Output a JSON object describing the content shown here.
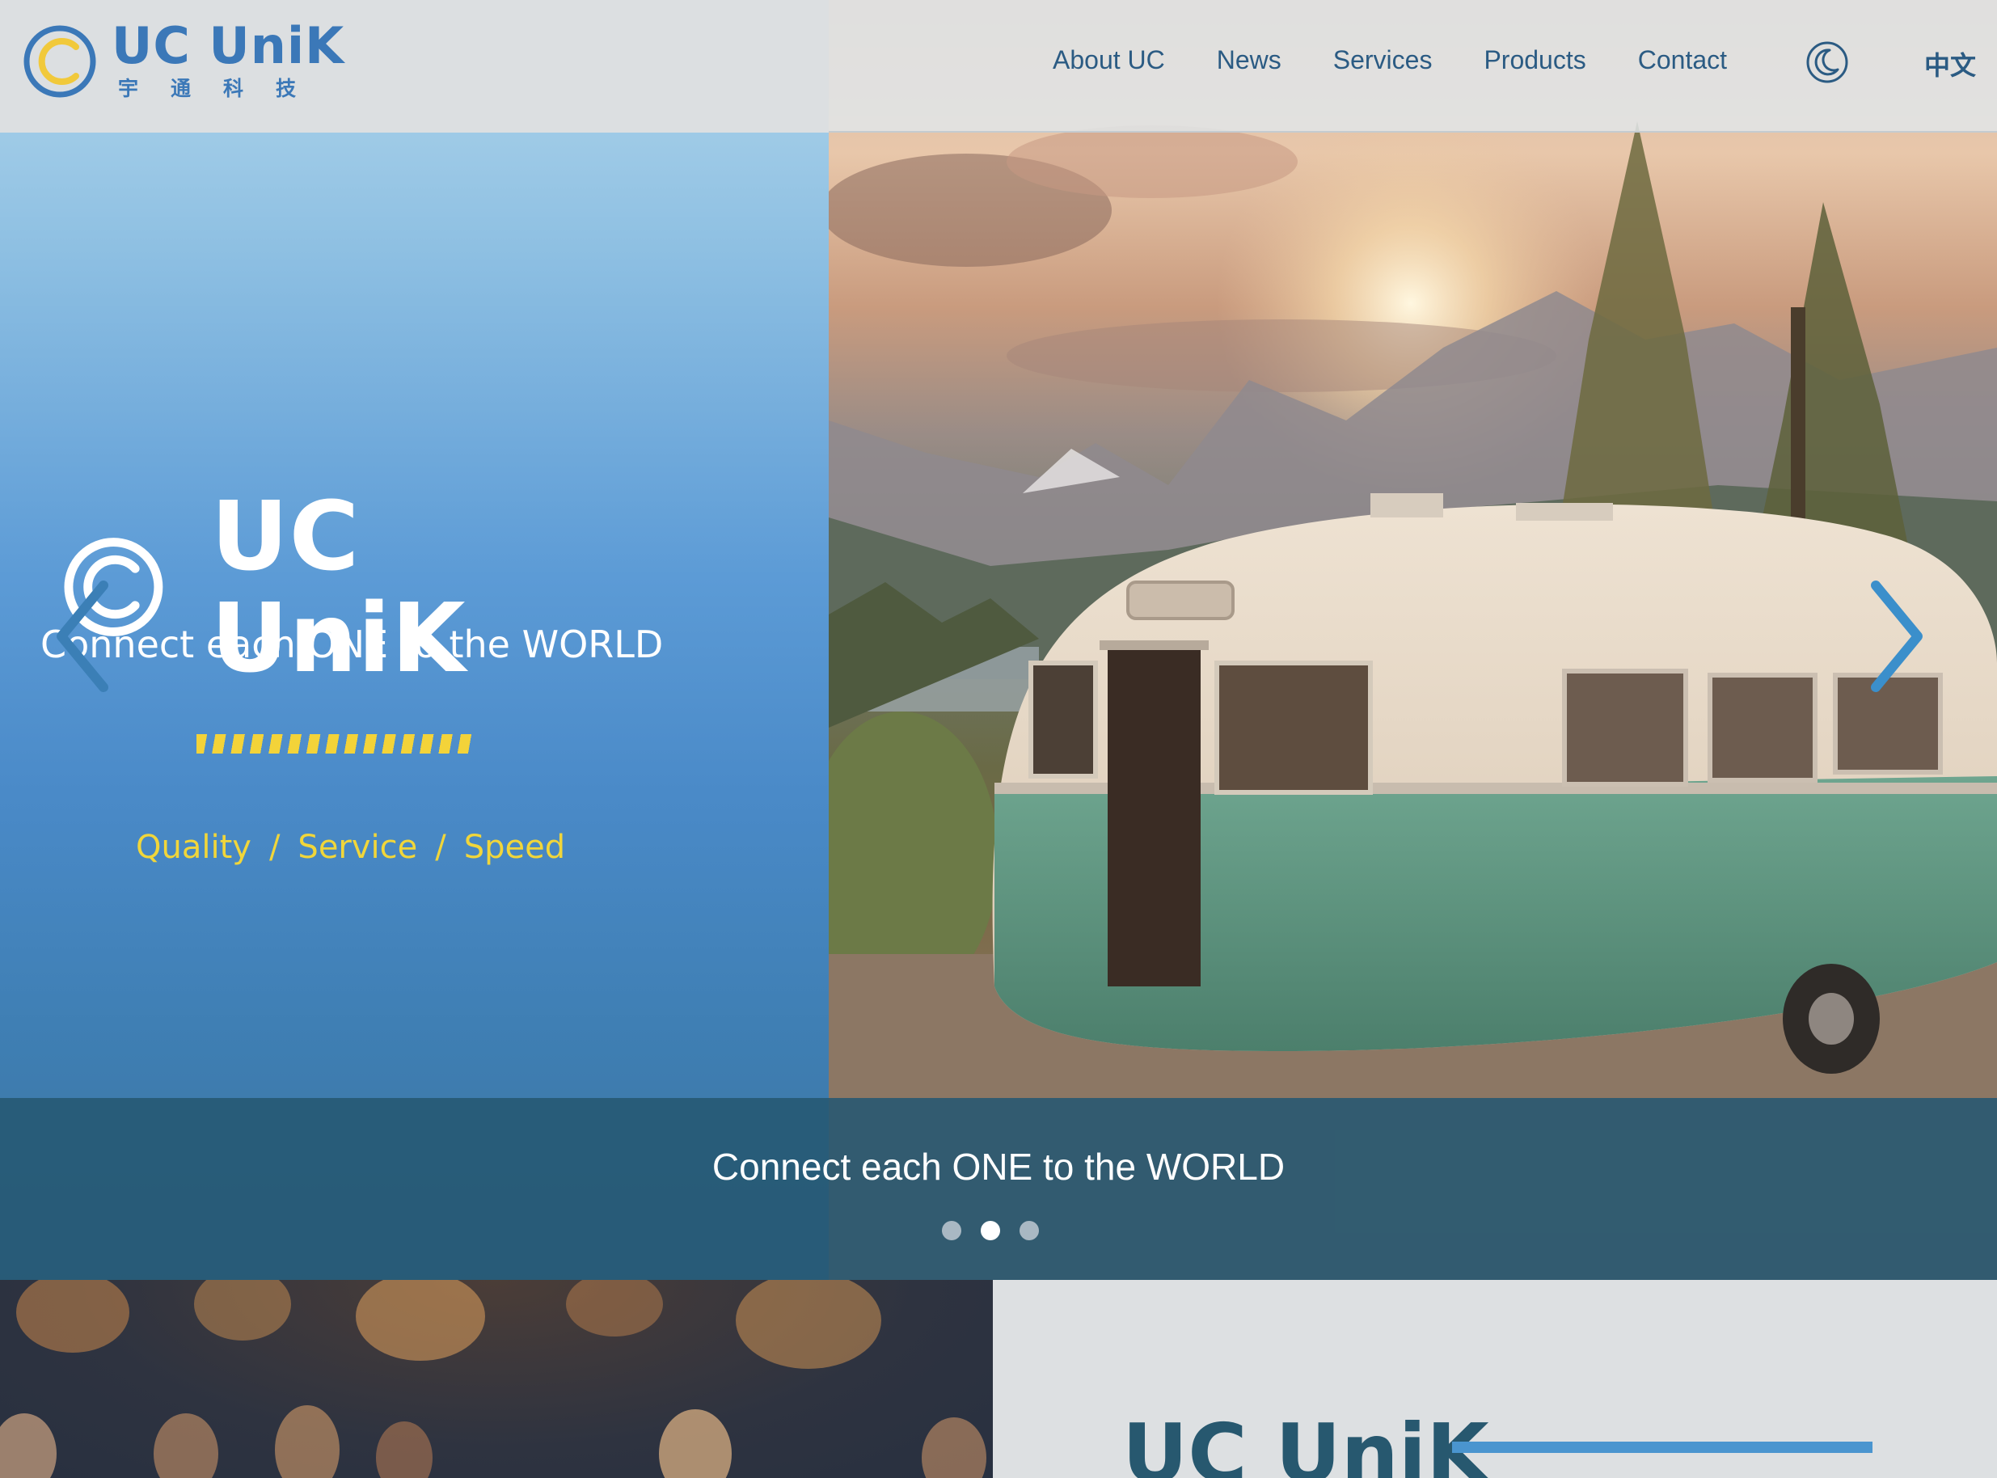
{
  "header": {
    "logo_title": "UC UniK",
    "logo_subtitle": "宇通科技",
    "nav": [
      "About UC",
      "News",
      "Services",
      "Products",
      "Contact"
    ],
    "theme_icon": "moon-icon",
    "language": "中文"
  },
  "hero": {
    "brand_title": "UC UniK",
    "tagline": "Connect each ONE to the WORLD",
    "features": [
      "Quality",
      "Service",
      "Speed"
    ],
    "feature_separator": "/",
    "caption": "Connect each ONE to the WORLD",
    "slides_count": 3,
    "active_slide": 2,
    "prev_icon": "chevron-left-icon",
    "next_icon": "chevron-right-icon"
  },
  "about": {
    "title": "UC UniK"
  },
  "colors": {
    "brand_blue": "#3b78b8",
    "nav_text": "#2b5b83",
    "accent_yellow": "#f1d63a",
    "caption_bar": "#265872",
    "section_title": "#27586f",
    "section_line": "#4a95cf"
  }
}
